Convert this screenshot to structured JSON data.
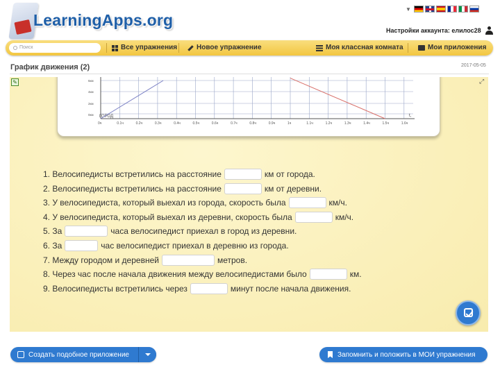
{
  "header": {
    "logo_text": "LearningApps.org",
    "account_label": "Настройки аккаунта: елилос28"
  },
  "languages": [
    "de",
    "en",
    "es",
    "fr",
    "it",
    "ru"
  ],
  "navbar": {
    "search_placeholder": "Поиск",
    "items": [
      {
        "label": "Все упражнения",
        "icon": "grid-icon"
      },
      {
        "label": "Новое упражнение",
        "icon": "pencil-icon"
      },
      {
        "label": "Моя классная комната",
        "icon": "list-icon"
      },
      {
        "label": "Мои приложения",
        "icon": "folder-icon"
      }
    ]
  },
  "page": {
    "title": "График движения (2)",
    "date": "2017-05-05"
  },
  "chart_data": {
    "type": "line",
    "title": "",
    "origin_label": "ГОРОД",
    "x_axis_label": "t,",
    "x_ticks": [
      "0ч",
      "0.1ч",
      "0.2ч",
      "0.3ч",
      "0.4ч",
      "0.5ч",
      "0.6ч",
      "0.7ч",
      "0.8ч",
      "0.9ч",
      "1ч",
      "1.1ч",
      "1.2ч",
      "1.3ч",
      "1.4ч",
      "1.5ч",
      "1.6ч"
    ],
    "y_ticks": [
      "0км",
      "2км",
      "4км",
      "6км"
    ],
    "series": [
      {
        "color": "#7a7fc4",
        "x": [
          0,
          0.33
        ],
        "y": [
          0,
          8
        ]
      },
      {
        "color": "#d9706a",
        "x": [
          1.0,
          1.5
        ],
        "y": [
          8.5,
          0
        ]
      }
    ]
  },
  "questions": [
    {
      "before": "1. Велосипедисты встретились на расстояние",
      "after": "км от города.",
      "value": ""
    },
    {
      "before": "2. Велосипедисты встретились на расстояние",
      "after": "км от деревни.",
      "value": ""
    },
    {
      "before": "3. У велосипедиста, который выехал из города, скорость была",
      "after": "км/ч.",
      "value": ""
    },
    {
      "before": "4. У велосипедиста, который выехал из деревни, скорость была",
      "after": "км/ч.",
      "value": ""
    },
    {
      "before": "5. За",
      "after": "часа велосипедист приехал в город из деревни.",
      "value": ""
    },
    {
      "before": "6. За",
      "after": "час велосипедист приехал в деревню из города.",
      "value": ""
    },
    {
      "before": "7. Между городом и деревней",
      "after": "метров.",
      "value": ""
    },
    {
      "before": "8. Через час после начала движения между велосипедистами было",
      "after": "км.",
      "value": ""
    },
    {
      "before": "9. Велосипедисты встретились через",
      "after": "минут после начала движения.",
      "value": ""
    }
  ],
  "buttons": {
    "create_similar": "Создать подобное приложение",
    "save_to_mine": "Запомнить и положить в МОИ упражнения"
  },
  "colors": {
    "accent": "#2f7ad0",
    "navbar": "#f2c640",
    "app_bg": "#fbf1b9"
  }
}
